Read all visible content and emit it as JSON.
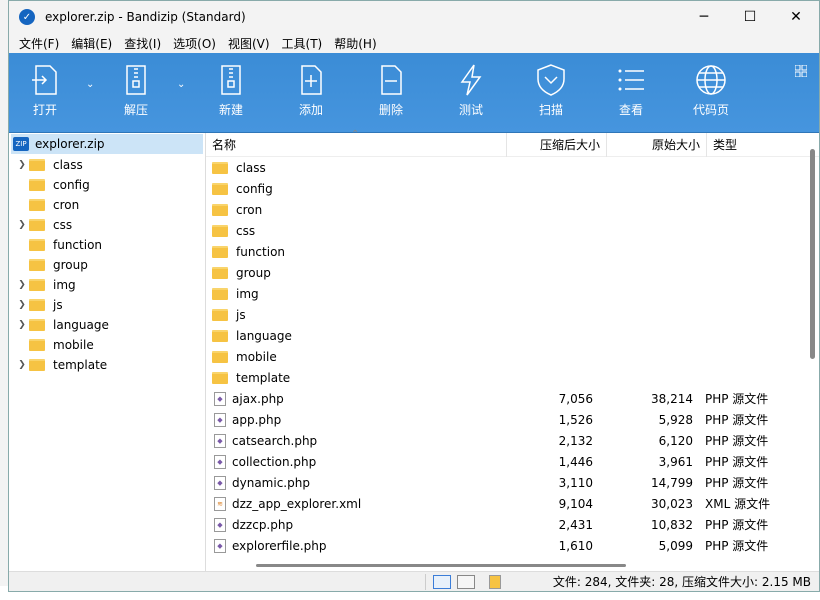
{
  "window": {
    "title": "explorer.zip - Bandizip (Standard)",
    "minimize": "─",
    "maximize": "☐",
    "close": "✕"
  },
  "menu": [
    "文件(F)",
    "编辑(E)",
    "查找(I)",
    "选项(O)",
    "视图(V)",
    "工具(T)",
    "帮助(H)"
  ],
  "toolbar": {
    "open": "打开",
    "extract": "解压",
    "new": "新建",
    "add": "添加",
    "delete": "删除",
    "test": "测试",
    "scan": "扫描",
    "view": "查看",
    "codepage": "代码页"
  },
  "tree": {
    "root": "explorer.zip",
    "items": [
      {
        "name": "class",
        "expandable": true
      },
      {
        "name": "config",
        "expandable": false
      },
      {
        "name": "cron",
        "expandable": false
      },
      {
        "name": "css",
        "expandable": true
      },
      {
        "name": "function",
        "expandable": false
      },
      {
        "name": "group",
        "expandable": false
      },
      {
        "name": "img",
        "expandable": true
      },
      {
        "name": "js",
        "expandable": true
      },
      {
        "name": "language",
        "expandable": true
      },
      {
        "name": "mobile",
        "expandable": false
      },
      {
        "name": "template",
        "expandable": true
      }
    ]
  },
  "columns": {
    "name": "名称",
    "compressed": "压缩后大小",
    "original": "原始大小",
    "type": "类型"
  },
  "files": [
    {
      "name": "class",
      "kind": "folder",
      "compressed": "",
      "original": "",
      "type": ""
    },
    {
      "name": "config",
      "kind": "folder",
      "compressed": "",
      "original": "",
      "type": ""
    },
    {
      "name": "cron",
      "kind": "folder",
      "compressed": "",
      "original": "",
      "type": ""
    },
    {
      "name": "css",
      "kind": "folder",
      "compressed": "",
      "original": "",
      "type": ""
    },
    {
      "name": "function",
      "kind": "folder",
      "compressed": "",
      "original": "",
      "type": ""
    },
    {
      "name": "group",
      "kind": "folder",
      "compressed": "",
      "original": "",
      "type": ""
    },
    {
      "name": "img",
      "kind": "folder",
      "compressed": "",
      "original": "",
      "type": ""
    },
    {
      "name": "js",
      "kind": "folder",
      "compressed": "",
      "original": "",
      "type": ""
    },
    {
      "name": "language",
      "kind": "folder",
      "compressed": "",
      "original": "",
      "type": ""
    },
    {
      "name": "mobile",
      "kind": "folder",
      "compressed": "",
      "original": "",
      "type": ""
    },
    {
      "name": "template",
      "kind": "folder",
      "compressed": "",
      "original": "",
      "type": ""
    },
    {
      "name": "ajax.php",
      "kind": "php",
      "compressed": "7,056",
      "original": "38,214",
      "type": "PHP 源文件"
    },
    {
      "name": "app.php",
      "kind": "php",
      "compressed": "1,526",
      "original": "5,928",
      "type": "PHP 源文件"
    },
    {
      "name": "catsearch.php",
      "kind": "php",
      "compressed": "2,132",
      "original": "6,120",
      "type": "PHP 源文件"
    },
    {
      "name": "collection.php",
      "kind": "php",
      "compressed": "1,446",
      "original": "3,961",
      "type": "PHP 源文件"
    },
    {
      "name": "dynamic.php",
      "kind": "php",
      "compressed": "3,110",
      "original": "14,799",
      "type": "PHP 源文件"
    },
    {
      "name": "dzz_app_explorer.xml",
      "kind": "xml",
      "compressed": "9,104",
      "original": "30,023",
      "type": "XML 源文件"
    },
    {
      "name": "dzzcp.php",
      "kind": "php",
      "compressed": "2,431",
      "original": "10,832",
      "type": "PHP 源文件"
    },
    {
      "name": "explorerfile.php",
      "kind": "php",
      "compressed": "1,610",
      "original": "5,099",
      "type": "PHP 源文件"
    }
  ],
  "status": {
    "summary": "文件: 284, 文件夹: 28, 压缩文件大小: 2.15 MB"
  },
  "colors": {
    "toolbar": "#3e8fd8",
    "selection": "#cce4f7",
    "folder": "#f6c343"
  }
}
